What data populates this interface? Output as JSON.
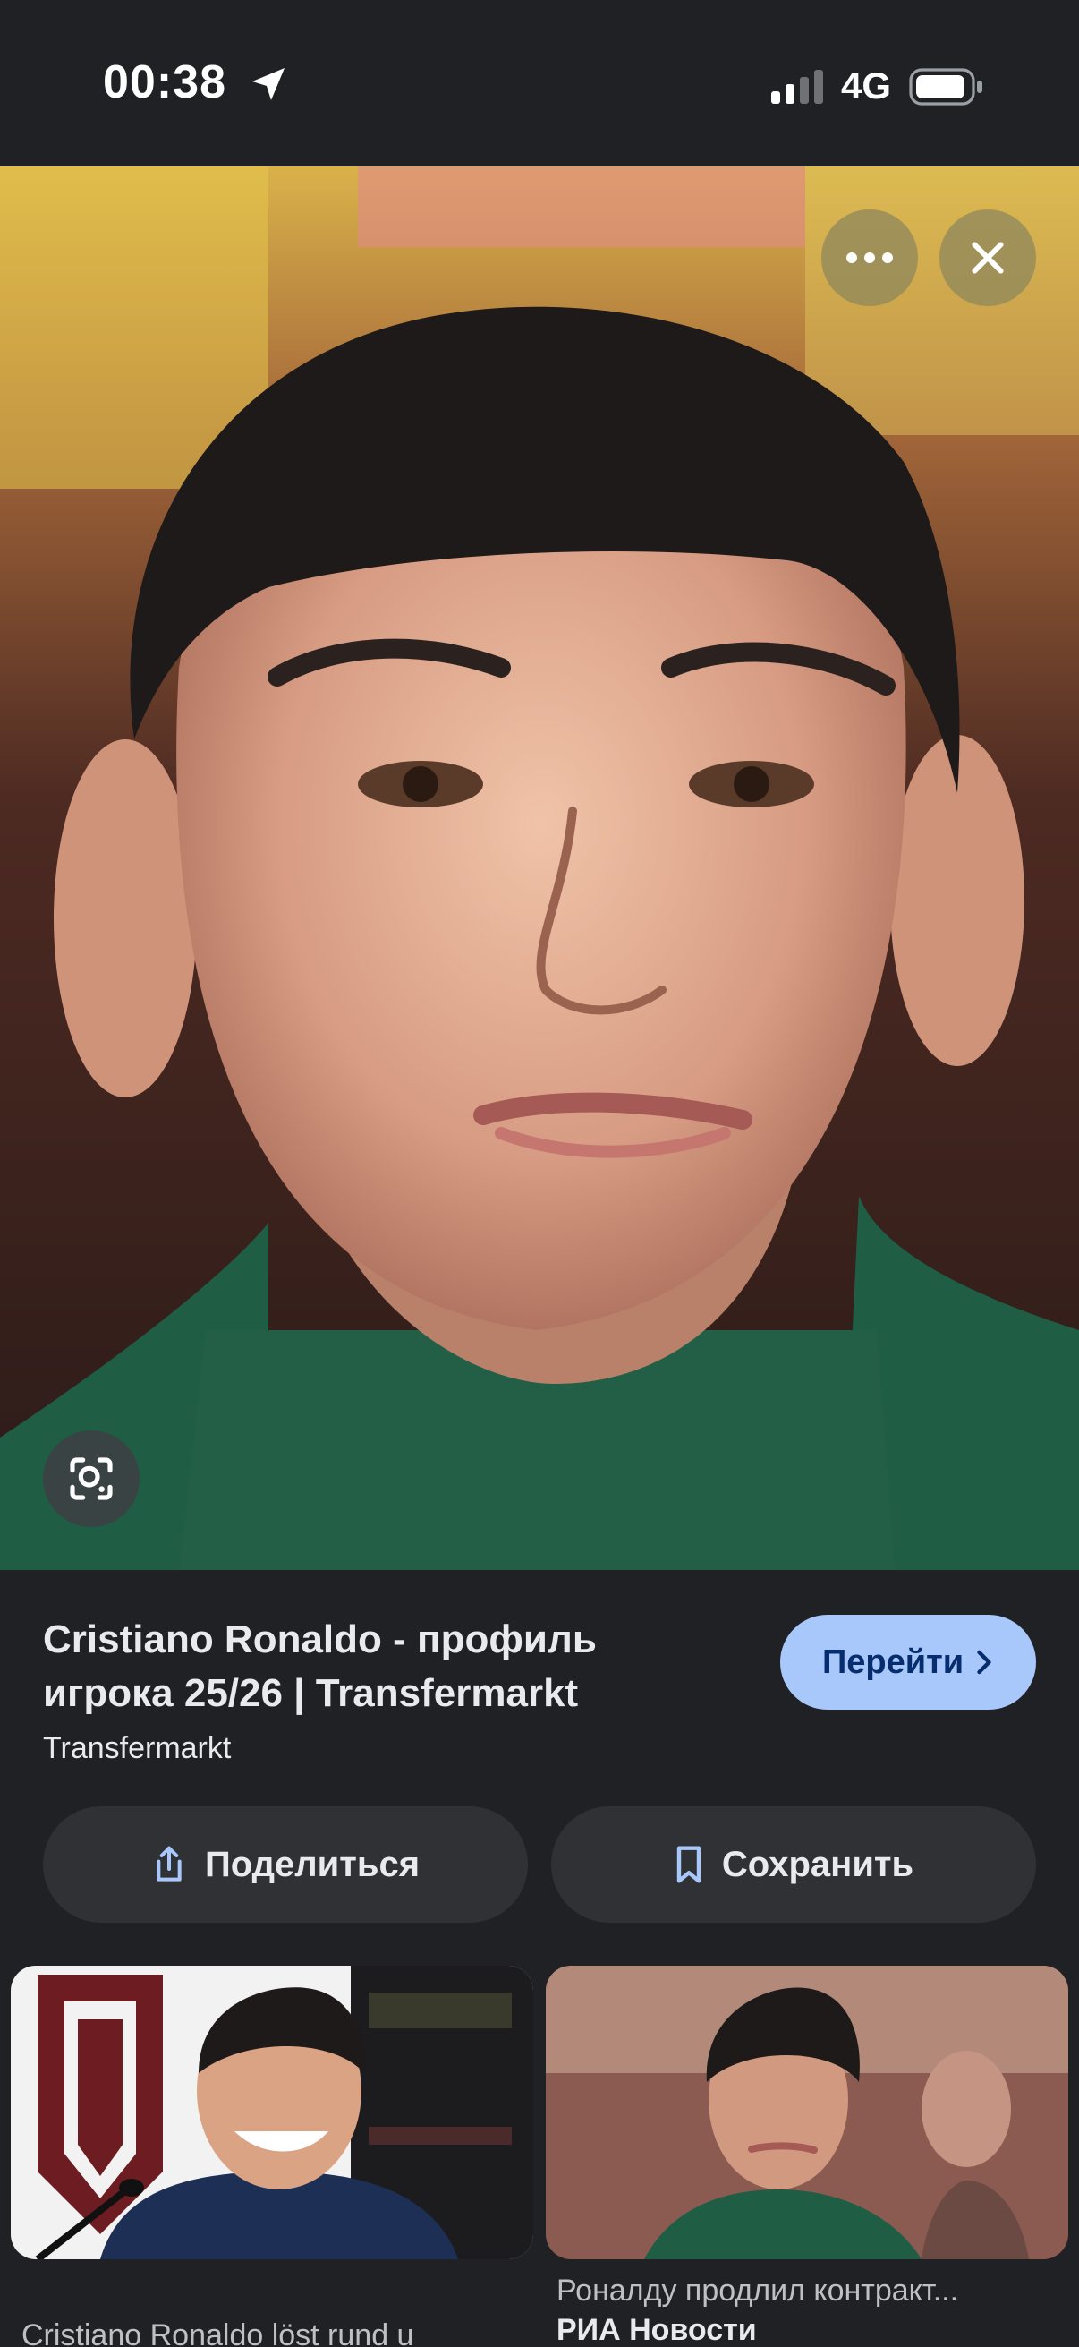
{
  "status_bar": {
    "time": "00:38",
    "network": "4G",
    "icons": [
      "location-arrow-icon",
      "signal-icon",
      "battery-icon"
    ]
  },
  "viewer": {
    "buttons": [
      "more-icon",
      "close-icon",
      "lens-icon"
    ]
  },
  "result": {
    "title": "Cristiano Ronaldo - профиль игрока 25/26 | Transfermarkt",
    "source": "Transfermarkt",
    "visit_label": "Перейти",
    "share_label": "Поделиться",
    "save_label": "Сохранить"
  },
  "related": [
    {
      "caption": "Cristiano Ronaldo löst rund u"
    },
    {
      "caption": "Роналду продлил контракт...",
      "source": "РИА Новости"
    }
  ],
  "colors": {
    "background": "#202124",
    "accent_button": "#a8c7fa",
    "accent_text": "#062e6f",
    "chip": "#303134"
  }
}
